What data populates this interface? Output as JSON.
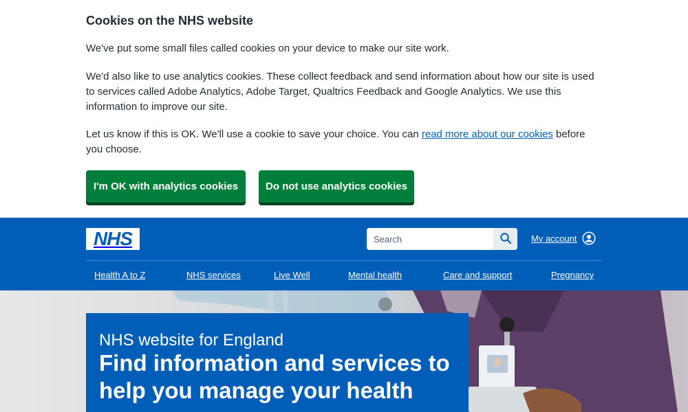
{
  "cookie_banner": {
    "title": "Cookies on the NHS website",
    "paragraph1": "We've put some small files called cookies on your device to make our site work.",
    "paragraph2": "We'd also like to use analytics cookies. These collect feedback and send information about how our site is used to services called Adobe Analytics, Adobe Target, Qualtrics Feedback and Google Analytics. We use this information to improve our site.",
    "paragraph3_before_link": "Let us know if this is OK. We'll use a cookie to save your choice. You can ",
    "paragraph3_link": "read more about our cookies",
    "paragraph3_after_link": " before you choose.",
    "accept_button": "I'm OK with analytics cookies",
    "reject_button": "Do not use analytics cookies"
  },
  "header": {
    "logo_text": "NHS",
    "search": {
      "placeholder": "Search",
      "value": ""
    },
    "account_link": "My account",
    "nav": [
      {
        "label": "Health A to Z"
      },
      {
        "label": "NHS services"
      },
      {
        "label": "Live Well"
      },
      {
        "label": "Mental health"
      },
      {
        "label": "Care and support"
      },
      {
        "label": "Pregnancy"
      }
    ]
  },
  "hero": {
    "subtitle": "NHS website for England",
    "title": "Find information and services to help you manage your health"
  },
  "colors": {
    "nhs_blue": "#005eb8",
    "button_green": "#007f3b",
    "text": "#212b32"
  },
  "icons": {
    "search": "search-icon",
    "account": "user-circle-icon"
  }
}
